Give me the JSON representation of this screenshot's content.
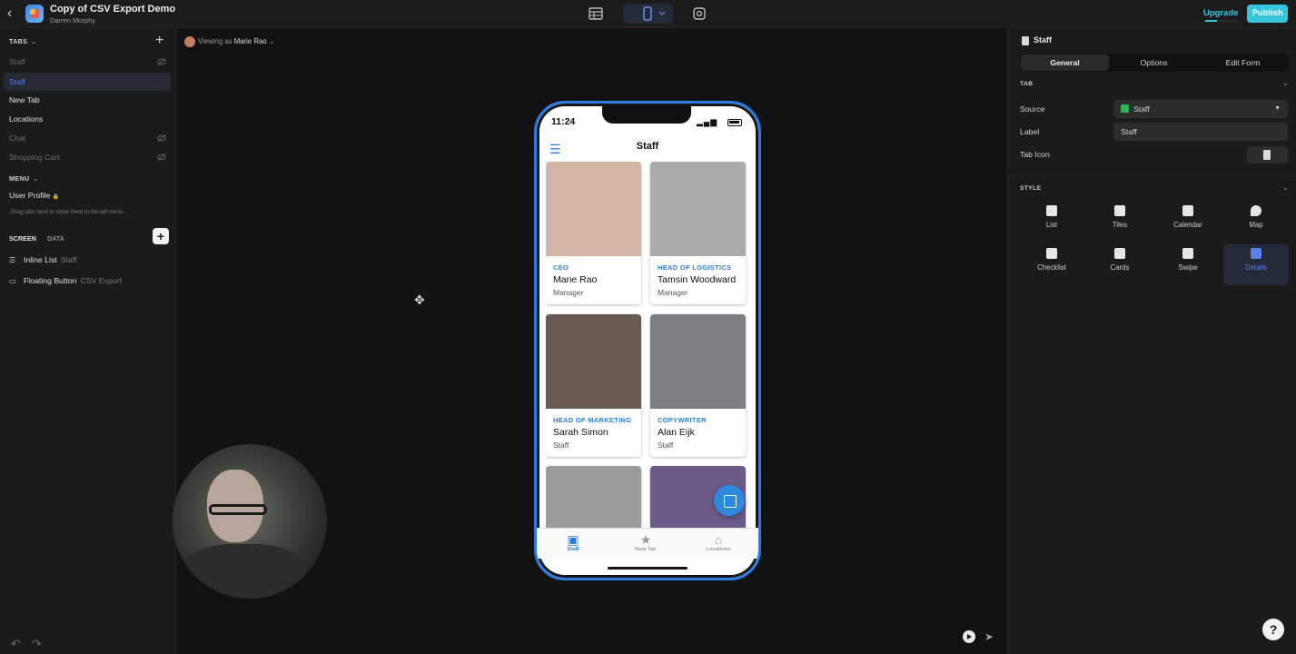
{
  "app": {
    "title": "Copy of CSV Export Demo",
    "owner": "Darren Murphy"
  },
  "toolbar": {
    "upgrade_label": "Upgrade",
    "publish_label": "Publish"
  },
  "sidebar": {
    "tabs_header": "TABS",
    "tabs": [
      {
        "label": "Staff",
        "hidden": true
      },
      {
        "label": "Staff",
        "active": true
      },
      {
        "label": "New Tab"
      },
      {
        "label": "Locations"
      },
      {
        "label": "Chat",
        "hidden": true
      },
      {
        "label": "Shopping Cart",
        "hidden": true
      }
    ],
    "menu_header": "MENU",
    "menu_item": "User Profile",
    "hint": "Drag tabs here to show them in the left menu.",
    "screen_tab": "SCREEN",
    "data_tab": "DATA",
    "components": [
      {
        "label": "Inline List",
        "sub": "Staff"
      },
      {
        "label": "Floating Button",
        "sub": "CSV Export"
      }
    ]
  },
  "canvas": {
    "viewing_prefix": "Viewing as",
    "viewing_name": "Marie Rao"
  },
  "phone": {
    "time": "11:24",
    "screen_title": "Staff",
    "cards": [
      {
        "role": "CEO",
        "name": "Marie Rao",
        "title": "Manager",
        "photo_color": "#d3b4a5"
      },
      {
        "role": "HEAD OF LOGISTICS",
        "name": "Tamsin Woodward",
        "title": "Manager",
        "photo_color": "#a9aba8"
      },
      {
        "role": "HEAD OF MARKETING",
        "name": "Sarah Simon",
        "title": "Staff",
        "photo_color": "#6a5a52"
      },
      {
        "role": "COPYWRITER",
        "name": "Alan Eijk",
        "title": "Staff",
        "photo_color": "#7b7f84"
      },
      {
        "role": "",
        "name": "",
        "title": "",
        "photo_color": "#9b9b98"
      },
      {
        "role": "",
        "name": "",
        "title": "",
        "photo_color": "#6b5a86"
      }
    ],
    "nav": [
      {
        "label": "Staff",
        "active": true
      },
      {
        "label": "New Tab"
      },
      {
        "label": "Locations"
      }
    ]
  },
  "rightpanel": {
    "header": "Staff",
    "segments": [
      "General",
      "Options",
      "Edit Form"
    ],
    "tab_section": "TAB",
    "source_label": "Source",
    "source_value": "Staff",
    "label_label": "Label",
    "label_value": "Staff",
    "tab_icon_label": "Tab Icon",
    "style_section": "STYLE",
    "styles": [
      "List",
      "Tiles",
      "Calendar",
      "Map",
      "Checklist",
      "Cards",
      "Swipe",
      "Details"
    ],
    "active_style": "Details"
  },
  "colors": {
    "accent": "#36c5dd",
    "active_nav": "#5d7fe8",
    "phone_accent": "#2e81d9"
  }
}
